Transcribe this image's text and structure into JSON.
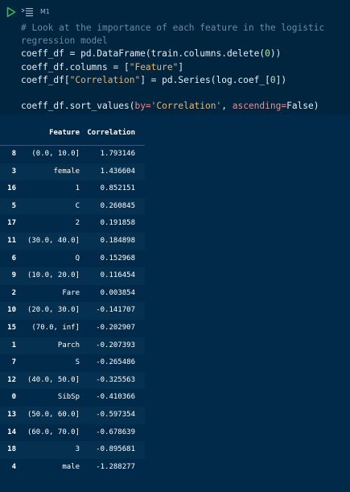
{
  "cell": {
    "label": "M1",
    "code_lines": [
      {
        "parts": [
          {
            "t": "# Look at the importance of each feature in the logistic",
            "c": "comment"
          }
        ]
      },
      {
        "parts": [
          {
            "t": "regression model",
            "c": "comment"
          }
        ]
      },
      {
        "parts": [
          {
            "t": "coeff_df = pd.DataFrame(train.columns.delete(",
            "c": ""
          },
          {
            "t": "0",
            "c": "num"
          },
          {
            "t": "))",
            "c": ""
          }
        ]
      },
      {
        "parts": [
          {
            "t": "coeff_df.columns = [",
            "c": ""
          },
          {
            "t": "\"Feature\"",
            "c": "string"
          },
          {
            "t": "]",
            "c": ""
          }
        ]
      },
      {
        "parts": [
          {
            "t": "coeff_df[",
            "c": ""
          },
          {
            "t": "\"Correlation\"",
            "c": "string"
          },
          {
            "t": "] = pd.Series(log.coef_[",
            "c": ""
          },
          {
            "t": "0",
            "c": "num"
          },
          {
            "t": "])",
            "c": ""
          }
        ]
      },
      {
        "parts": []
      },
      {
        "parts": [
          {
            "t": "coeff_df.sort_values(",
            "c": ""
          },
          {
            "t": "by=",
            "c": "param"
          },
          {
            "t": "'Correlation'",
            "c": "string"
          },
          {
            "t": ", ",
            "c": ""
          },
          {
            "t": "ascending=",
            "c": "param"
          },
          {
            "t": "False)",
            "c": ""
          }
        ]
      }
    ]
  },
  "output": {
    "headers": {
      "feature": "Feature",
      "correlation": "Correlation"
    },
    "rows": [
      {
        "index": "8",
        "feature": "(0.0, 10.0]",
        "correlation": "1.793146"
      },
      {
        "index": "3",
        "feature": "female",
        "correlation": "1.436604"
      },
      {
        "index": "16",
        "feature": "1",
        "correlation": "0.852151"
      },
      {
        "index": "5",
        "feature": "C",
        "correlation": "0.260845"
      },
      {
        "index": "17",
        "feature": "2",
        "correlation": "0.191858"
      },
      {
        "index": "11",
        "feature": "(30.0, 40.0]",
        "correlation": "0.184898"
      },
      {
        "index": "6",
        "feature": "Q",
        "correlation": "0.152968"
      },
      {
        "index": "9",
        "feature": "(10.0, 20.0]",
        "correlation": "0.116454"
      },
      {
        "index": "2",
        "feature": "Fare",
        "correlation": "0.003854"
      },
      {
        "index": "10",
        "feature": "(20.0, 30.0]",
        "correlation": "-0.141707"
      },
      {
        "index": "15",
        "feature": "(70.0, inf]",
        "correlation": "-0.202907"
      },
      {
        "index": "1",
        "feature": "Parch",
        "correlation": "-0.207393"
      },
      {
        "index": "7",
        "feature": "S",
        "correlation": "-0.265486"
      },
      {
        "index": "12",
        "feature": "(40.0, 50.0]",
        "correlation": "-0.325563"
      },
      {
        "index": "0",
        "feature": "SibSp",
        "correlation": "-0.410366"
      },
      {
        "index": "13",
        "feature": "(50.0, 60.0]",
        "correlation": "-0.597354"
      },
      {
        "index": "14",
        "feature": "(60.0, 70.0]",
        "correlation": "-0.678639"
      },
      {
        "index": "18",
        "feature": "3",
        "correlation": "-0.895681"
      },
      {
        "index": "4",
        "feature": "male",
        "correlation": "-1.288277"
      }
    ]
  },
  "icons": {
    "run": "run-icon",
    "menu": "cell-menu-icon"
  },
  "colors": {
    "background": "#012a4a",
    "cell_background": "#01243f",
    "run_icon": "#3fb950",
    "comment": "#6b8aa6",
    "string": "#e6b673",
    "param": "#f08c8c"
  }
}
